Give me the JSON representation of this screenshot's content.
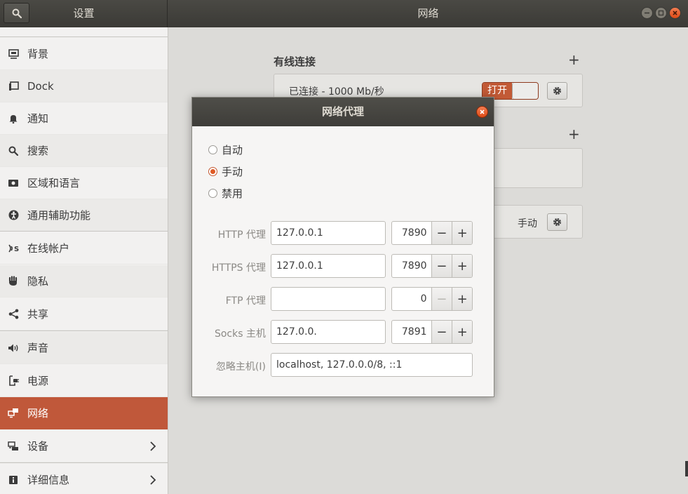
{
  "header": {
    "left_title": "设置",
    "main_title": "网络"
  },
  "sidebar": {
    "items": [
      {
        "label": "背景"
      },
      {
        "label": "Dock"
      },
      {
        "label": "通知"
      },
      {
        "label": "搜索"
      },
      {
        "label": "区域和语言"
      },
      {
        "label": "通用辅助功能"
      },
      {
        "label": "在线帐户"
      },
      {
        "label": "隐私"
      },
      {
        "label": "共享"
      },
      {
        "label": "声音"
      },
      {
        "label": "电源"
      },
      {
        "label": "网络",
        "active": true
      },
      {
        "label": "设备"
      },
      {
        "label": "详细信息"
      }
    ]
  },
  "main": {
    "wired_title": "有线连接",
    "wired_status": "已连接 - 1000 Mb/秒",
    "switch_on_label": "打开",
    "proxy_mode": "手动"
  },
  "dialog": {
    "title": "网络代理",
    "radios": [
      {
        "label": "自动",
        "checked": false
      },
      {
        "label": "手动",
        "checked": true
      },
      {
        "label": "禁用",
        "checked": false
      }
    ],
    "rows": [
      {
        "label": "HTTP 代理",
        "host": "127.0.0.1",
        "port": "7890"
      },
      {
        "label": "HTTPS 代理",
        "host": "127.0.0.1",
        "port": "7890"
      },
      {
        "label": "FTP 代理",
        "host": "",
        "port": "0"
      },
      {
        "label": "Socks 主机",
        "host": "127.0.0.",
        "port": "7891"
      }
    ],
    "ignore_label": "忽略主机(I)",
    "ignore_value": "localhost, 127.0.0.0/8, ::1"
  },
  "colors": {
    "accent": "#c0583a",
    "header_bg": "#3b3a36"
  }
}
